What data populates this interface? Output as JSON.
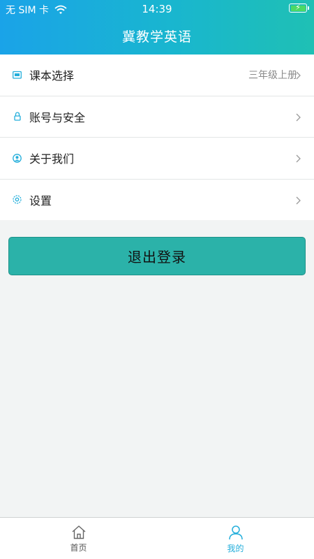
{
  "status_bar": {
    "carrier": "无 SIM 卡",
    "time": "14:39"
  },
  "header": {
    "title": "冀教学英语"
  },
  "menu": {
    "items": [
      {
        "label": "课本选择",
        "value": "三年级上册",
        "icon": "book-icon"
      },
      {
        "label": "账号与安全",
        "value": "",
        "icon": "lock-icon"
      },
      {
        "label": "关于我们",
        "value": "",
        "icon": "user-circle-icon"
      },
      {
        "label": "设置",
        "value": "",
        "icon": "gear-icon"
      }
    ]
  },
  "logout": {
    "label": "退出登录"
  },
  "tabbar": {
    "tabs": [
      {
        "label": "首页",
        "icon": "home-icon",
        "active": false
      },
      {
        "label": "我的",
        "icon": "profile-icon",
        "active": true
      }
    ]
  },
  "colors": {
    "accent": "#2bb2a9",
    "header_start": "#1aa3e8",
    "header_end": "#1fc0b4",
    "active_tab": "#23aedb"
  }
}
